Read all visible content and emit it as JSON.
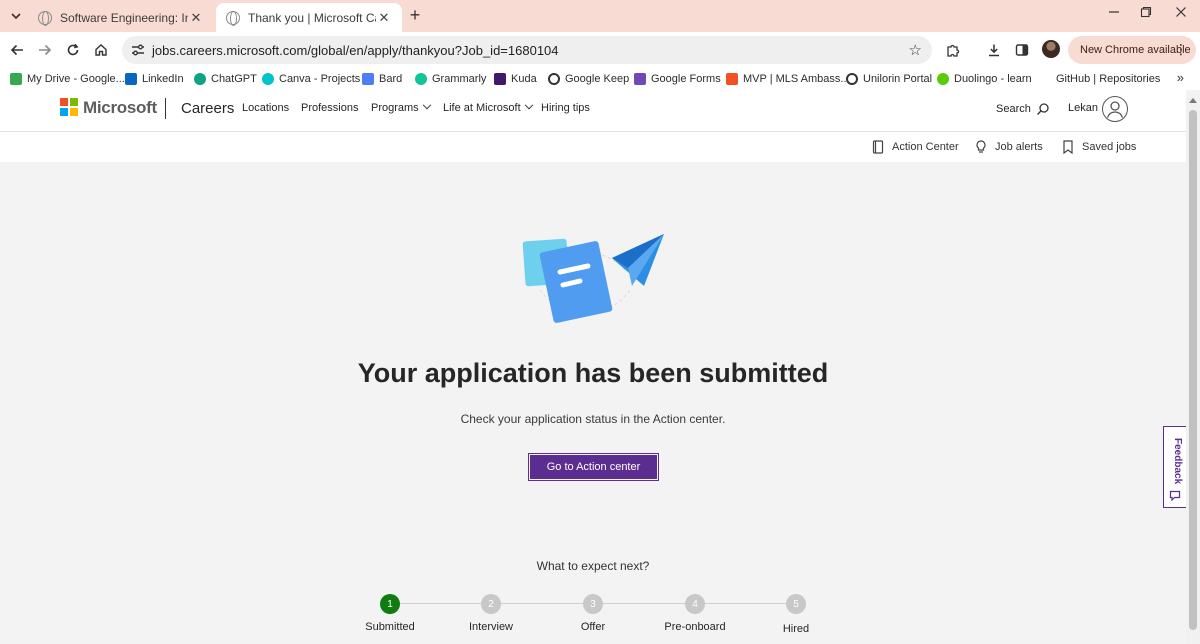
{
  "browser": {
    "tabs": [
      {
        "title": "Software Engineering: Internship",
        "active": false
      },
      {
        "title": "Thank you | Microsoft Careers",
        "active": true
      }
    ],
    "url": "jobs.careers.microsoft.com/global/en/apply/thankyou?Job_id=1680104",
    "new_chrome_label": "New Chrome available",
    "bookmarks": [
      {
        "label": "My Drive - Google...",
        "icon": "google-drive-icon",
        "color": "#34a853"
      },
      {
        "label": "LinkedIn",
        "icon": "linkedin-icon",
        "color": "#0a66c2"
      },
      {
        "label": "ChatGPT",
        "icon": "chatgpt-icon",
        "color": "#10a37f"
      },
      {
        "label": "Canva - Projects",
        "icon": "canva-icon",
        "color": "#00c4cc"
      },
      {
        "label": "Bard",
        "icon": "bard-icon",
        "color": "#4f7df3"
      },
      {
        "label": "Grammarly",
        "icon": "grammarly-icon",
        "color": "#15c39a"
      },
      {
        "label": "Kuda",
        "icon": "kuda-icon",
        "color": "#40196d"
      },
      {
        "label": "Google Keep",
        "icon": "globe-icon",
        "color": "#333333"
      },
      {
        "label": "Google Forms",
        "icon": "google-forms-icon",
        "color": "#7248b9"
      },
      {
        "label": "MVP | MLS Ambass...",
        "icon": "microsoft-icon",
        "color": "#f25022"
      },
      {
        "label": "Unilorin Portal",
        "icon": "globe-icon",
        "color": "#333333"
      },
      {
        "label": "Duolingo - learn",
        "icon": "duolingo-icon",
        "color": "#58cc02"
      },
      {
        "label": "GitHub | Repositories",
        "icon": "github-icon",
        "color": "#ffffff"
      }
    ]
  },
  "header": {
    "brand": "Microsoft",
    "section": "Careers",
    "nav": [
      "Locations",
      "Professions",
      "Programs",
      "Life at Microsoft",
      "Hiring tips"
    ],
    "search_label": "Search",
    "user_name": "Lekan"
  },
  "utility_links": [
    "Action Center",
    "Job alerts",
    "Saved jobs"
  ],
  "confirmation": {
    "headline": "Your application has been submitted",
    "subline": "Check your application status in the Action center.",
    "cta_label": "Go to Action center"
  },
  "next_steps": {
    "heading": "What to expect next?",
    "steps": [
      {
        "number": "1",
        "label": "Submitted",
        "current": true
      },
      {
        "number": "2",
        "label": "Interview",
        "current": false
      },
      {
        "number": "3",
        "label": "Offer",
        "current": false
      },
      {
        "number": "4",
        "label": "Pre-onboard",
        "current": false
      },
      {
        "number": "5",
        "label": "Hired",
        "current": false
      }
    ]
  },
  "feedback_label": "Feedback",
  "colors": {
    "accent": "#5c2d91",
    "step_current": "#107c10",
    "step_pending": "#c8c8c8",
    "tab_strip": "#f8dcd3"
  }
}
